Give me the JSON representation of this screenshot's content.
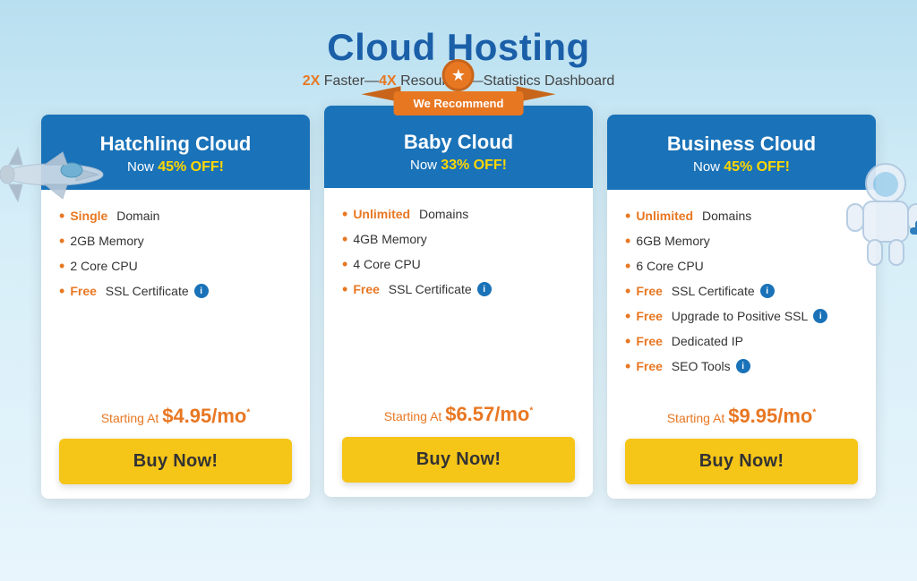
{
  "page": {
    "title": "Cloud Hosting",
    "subtitle_parts": [
      {
        "text": "2X",
        "bold": true
      },
      {
        "text": " Faster—",
        "bold": false
      },
      {
        "text": "4X",
        "bold": true
      },
      {
        "text": " Resources—Statistics Dashboard",
        "bold": false
      }
    ],
    "subtitle": "2X Faster—4X Resources—Statistics Dashboard"
  },
  "badge": {
    "label": "We Recommend"
  },
  "cards": [
    {
      "id": "hatchling",
      "title": "Hatchling Cloud",
      "discount_prefix": "Now ",
      "discount": "45% OFF!",
      "features": [
        {
          "bold": "Single",
          "rest": " Domain"
        },
        {
          "bold": "",
          "rest": "2GB Memory"
        },
        {
          "bold": "",
          "rest": "2 Core CPU"
        },
        {
          "bold": "Free",
          "rest": " SSL Certificate",
          "info": true
        }
      ],
      "pricing_prefix": "Starting At ",
      "price": "$4.95/mo",
      "price_sup": "*",
      "buy_label": "Buy Now!",
      "featured": false
    },
    {
      "id": "baby",
      "title": "Baby Cloud",
      "discount_prefix": "Now ",
      "discount": "33% OFF!",
      "features": [
        {
          "bold": "Unlimited",
          "rest": " Domains"
        },
        {
          "bold": "",
          "rest": "4GB Memory"
        },
        {
          "bold": "",
          "rest": "4 Core CPU"
        },
        {
          "bold": "Free",
          "rest": " SSL Certificate",
          "info": true
        }
      ],
      "pricing_prefix": "Starting At ",
      "price": "$6.57/mo",
      "price_sup": "*",
      "buy_label": "Buy Now!",
      "featured": true
    },
    {
      "id": "business",
      "title": "Business Cloud",
      "discount_prefix": "Now ",
      "discount": "45% OFF!",
      "features": [
        {
          "bold": "Unlimited",
          "rest": " Domains"
        },
        {
          "bold": "",
          "rest": "6GB Memory"
        },
        {
          "bold": "",
          "rest": "6 Core CPU"
        },
        {
          "bold": "Free",
          "rest": " SSL Certificate",
          "info": true
        },
        {
          "bold": "Free",
          "rest": " Upgrade to Positive SSL",
          "info": true
        },
        {
          "bold": "Free",
          "rest": " Dedicated IP"
        },
        {
          "bold": "Free",
          "rest": " SEO Tools",
          "info": true
        }
      ],
      "pricing_prefix": "Starting At ",
      "price": "$9.95/mo",
      "price_sup": "*",
      "buy_label": "Buy Now!",
      "featured": false
    }
  ],
  "colors": {
    "header_bg": "#1a72b8",
    "accent": "#e87722",
    "btn_bg": "#f5c518",
    "title_color": "#1a5fa8"
  }
}
